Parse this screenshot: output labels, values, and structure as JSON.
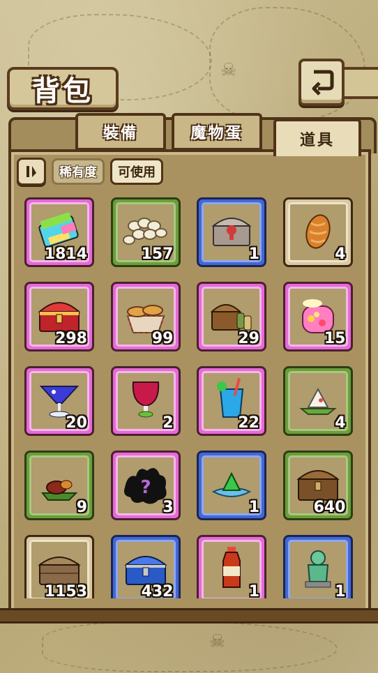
{
  "header": {
    "title": "背包",
    "back_icon": "return-arrow-icon"
  },
  "tabs": [
    {
      "label": "裝備",
      "active": false
    },
    {
      "label": "魔物蛋",
      "active": false
    },
    {
      "label": "道具",
      "active": true
    }
  ],
  "filters": {
    "sort_icon": "sort-toggle-icon",
    "rarity_label": "稀有度",
    "usable_label": "可使用",
    "usable_active": true
  },
  "colors": {
    "rarity_pink": "#e66ad6",
    "rarity_green": "#6c9e3a",
    "rarity_blue": "#4268d2",
    "rarity_tan": "#d8c9a4"
  },
  "items": [
    {
      "icon": "rainbow-eraser-icon",
      "qty": "1814",
      "rarity": "pink"
    },
    {
      "icon": "beans-pile-icon",
      "qty": "157",
      "rarity": "green"
    },
    {
      "icon": "locked-chest-icon",
      "qty": "1",
      "rarity": "blue"
    },
    {
      "icon": "bread-roll-icon",
      "qty": "4",
      "rarity": "tan"
    },
    {
      "icon": "red-treasure-chest-icon",
      "qty": "298",
      "rarity": "pink"
    },
    {
      "icon": "bread-basket-icon",
      "qty": "99",
      "rarity": "pink"
    },
    {
      "icon": "supply-chest-icon",
      "qty": "29",
      "rarity": "pink"
    },
    {
      "icon": "fruit-jar-drink-icon",
      "qty": "15",
      "rarity": "pink"
    },
    {
      "icon": "blue-cocktail-icon",
      "qty": "20",
      "rarity": "pink"
    },
    {
      "icon": "red-goblet-icon",
      "qty": "2",
      "rarity": "pink"
    },
    {
      "icon": "blue-soda-cup-icon",
      "qty": "22",
      "rarity": "pink"
    },
    {
      "icon": "rice-dumpling-icon",
      "qty": "4",
      "rarity": "green"
    },
    {
      "icon": "roasted-meat-icon",
      "qty": "9",
      "rarity": "green"
    },
    {
      "icon": "mystery-shadow-icon",
      "qty": "3",
      "rarity": "pink"
    },
    {
      "icon": "green-crystal-icon",
      "qty": "1",
      "rarity": "blue"
    },
    {
      "icon": "wooden-chest-icon",
      "qty": "640",
      "rarity": "green"
    },
    {
      "icon": "plain-wood-chest-icon",
      "qty": "1153",
      "rarity": "tan"
    },
    {
      "icon": "blue-chest-icon",
      "qty": "432",
      "rarity": "blue"
    },
    {
      "icon": "tea-bottle-icon",
      "qty": "1",
      "rarity": "pink"
    },
    {
      "icon": "jade-knight-statue-icon",
      "qty": "1",
      "rarity": "blue"
    }
  ]
}
